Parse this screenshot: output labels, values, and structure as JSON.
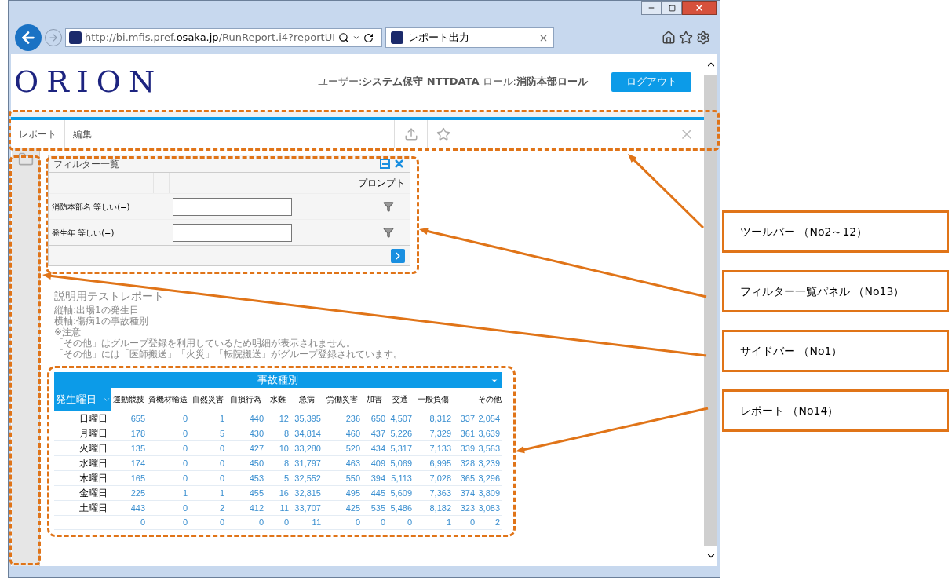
{
  "browser": {
    "url_start": "http://bi.mfis.pref.",
    "url_domain": "osaka.jp",
    "url_end": "/RunReport.i4?reportUI",
    "tab_title": "レポート出力"
  },
  "header": {
    "logo": "ORION",
    "user_label": "ユーザー:",
    "user_name": "システム保守 NTTDATA",
    "role_label": "ロール:",
    "role_name": "消防本部ロール",
    "logout": "ログアウト"
  },
  "toolbar": {
    "items": [
      "レポート",
      "編集"
    ]
  },
  "filter_panel": {
    "title": "フィルター一覧",
    "prompt_header": "プロンプト",
    "rows": [
      {
        "label": "消防本部名 等しい(=)"
      },
      {
        "label": "発生年 等しい(=)"
      }
    ]
  },
  "report": {
    "title": "説明用テストレポート",
    "lines": [
      "縦軸:出場1の発生日",
      "横軸:傷病1の事故種別",
      "※注意",
      "「その他」はグループ登録を利用しているため明細が表示されません。",
      "「その他」には「医師搬送」「火災」「転院搬送」がグループ登録されています。"
    ]
  },
  "table": {
    "column_group": "事故種別",
    "row_header": "発生曜日",
    "columns": [
      {
        "kind": "labeled",
        "label": "運動競技"
      },
      {
        "kind": "labeled",
        "label": "資機材輸送"
      },
      {
        "kind": "labeled",
        "label": "自然災害"
      },
      {
        "kind": "labeled",
        "label": "自損行為"
      },
      {
        "kind": "labeled",
        "label": "水難"
      },
      {
        "kind": "labeled",
        "label": "急病"
      },
      {
        "kind": "labeled",
        "label": "労働災害"
      },
      {
        "kind": "labeled",
        "label": "加害"
      },
      {
        "kind": "labeled",
        "label": "交通"
      },
      {
        "kind": "labeled",
        "label": "一般負傷"
      },
      {
        "kind": "unlabeled"
      },
      {
        "kind": "labeled",
        "label": "その他"
      }
    ],
    "rows": [
      {
        "label": "日曜日",
        "cells": [
          "655",
          "0",
          "1",
          "440",
          "12",
          "35,395",
          "236",
          "650",
          "4,507",
          "8,312",
          "337",
          "2,054"
        ]
      },
      {
        "label": "月曜日",
        "cells": [
          "178",
          "0",
          "5",
          "430",
          "8",
          "34,814",
          "460",
          "437",
          "5,226",
          "7,329",
          "361",
          "3,639"
        ]
      },
      {
        "label": "火曜日",
        "cells": [
          "135",
          "0",
          "0",
          "427",
          "10",
          "33,280",
          "520",
          "434",
          "5,317",
          "7,133",
          "339",
          "3,563"
        ]
      },
      {
        "label": "水曜日",
        "cells": [
          "174",
          "0",
          "0",
          "450",
          "8",
          "31,797",
          "463",
          "409",
          "5,069",
          "6,995",
          "328",
          "3,239"
        ]
      },
      {
        "label": "木曜日",
        "cells": [
          "165",
          "0",
          "0",
          "453",
          "5",
          "32,552",
          "550",
          "394",
          "5,113",
          "7,028",
          "365",
          "3,296"
        ]
      },
      {
        "label": "金曜日",
        "cells": [
          "225",
          "1",
          "1",
          "455",
          "16",
          "32,815",
          "495",
          "445",
          "5,609",
          "7,363",
          "374",
          "3,809"
        ]
      },
      {
        "label": "土曜日",
        "cells": [
          "443",
          "0",
          "2",
          "412",
          "11",
          "33,707",
          "425",
          "535",
          "5,486",
          "8,182",
          "323",
          "3,083"
        ]
      },
      {
        "cells": [
          "0",
          "0",
          "0",
          "0",
          "0",
          "11",
          "0",
          "0",
          "0",
          "1",
          "0",
          "2"
        ]
      }
    ]
  },
  "callouts": [
    {
      "text": "ツールバー （No2～12）"
    },
    {
      "text": "フィルター一覧パネル （No13）"
    },
    {
      "text": "サイドバー （No1）"
    },
    {
      "text": "レポート （No14）"
    }
  ]
}
